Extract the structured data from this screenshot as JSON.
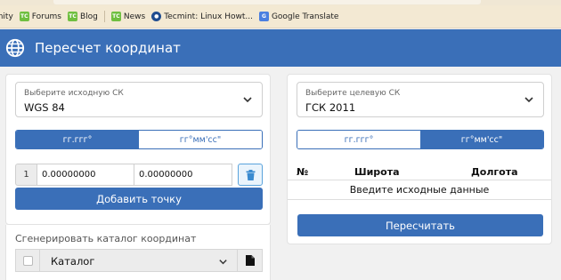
{
  "bookmarks": [
    {
      "label": "unity",
      "icon": "none"
    },
    {
      "label": "Forums",
      "icon": "green-bookmark-icon"
    },
    {
      "label": "Blog",
      "icon": "green-bookmark-icon"
    },
    {
      "label": "News",
      "icon": "green-bookmark-icon"
    },
    {
      "label": "Tecmint: Linux Howt...",
      "icon": "tecmint-icon"
    },
    {
      "label": "Google Translate",
      "icon": "google-translate-icon"
    }
  ],
  "app": {
    "title": "Пересчет координат",
    "accent": "#3a6fb8"
  },
  "source": {
    "select_label": "Выберите исходную СК",
    "select_value": "WGS 84",
    "format_options": [
      "гг.ггг°",
      "гг°мм'сс\""
    ],
    "active_format": 0,
    "point": {
      "index": "1",
      "lat": "0.00000000",
      "lon": "0.00000000"
    },
    "add_button": "Добавить точку"
  },
  "catalog": {
    "label": "Сгенерировать каталог координат",
    "select_value": "Каталог"
  },
  "target": {
    "select_label": "Выберите целевую СК",
    "select_value": "ГСК 2011",
    "format_options": [
      "гг.ггг°",
      "гг°мм'сс\""
    ],
    "active_format": 1,
    "table_headers": [
      "№",
      "Широта",
      "Долгота"
    ],
    "empty_text": "Введите исходные данные",
    "recalc_button": "Пересчитать"
  }
}
